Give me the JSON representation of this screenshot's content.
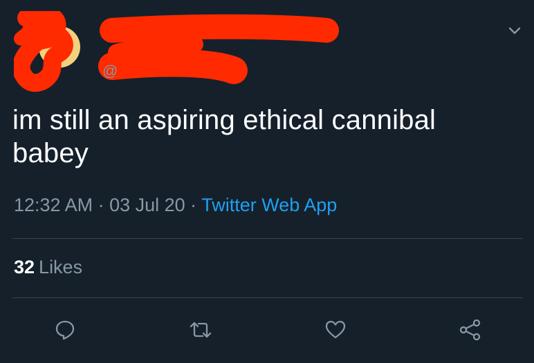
{
  "tweet": {
    "handle_prefix": "@",
    "text_line1": "im still an aspiring ethical cannibal",
    "text_line2": "babey",
    "time": "12:32 AM",
    "separator": " · ",
    "date": "03 Jul 20",
    "source": "Twitter Web App",
    "likes_count": "32",
    "likes_label": "Likes"
  },
  "icons": {
    "menu": "chevron-down-icon",
    "reply": "reply-icon",
    "retweet": "retweet-icon",
    "like": "heart-icon",
    "share": "share-icon"
  },
  "colors": {
    "background": "#15202b",
    "text": "#ffffff",
    "secondary": "#8899a6",
    "link": "#1da1f2",
    "redaction": "#ff2a00"
  }
}
